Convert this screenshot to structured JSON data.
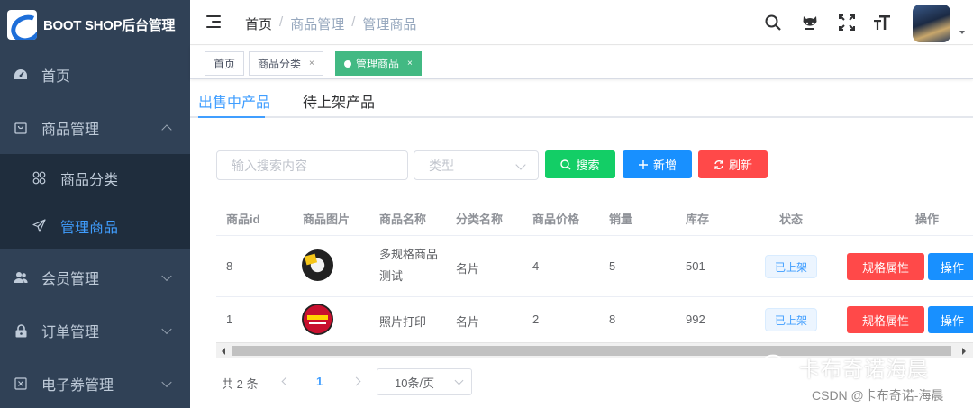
{
  "app": {
    "title": "BOOT SHOP后台管理"
  },
  "sidebar": {
    "items": [
      {
        "label": "首页",
        "icon": "dashboard-icon"
      },
      {
        "label": "商品管理",
        "icon": "shopping-bag-icon",
        "expanded": true
      },
      {
        "label": "会员管理",
        "icon": "users-icon"
      },
      {
        "label": "订单管理",
        "icon": "lock-icon"
      },
      {
        "label": "电子券管理",
        "icon": "coupon-icon"
      }
    ],
    "submenu": [
      {
        "label": "商品分类",
        "icon": "categories-icon"
      },
      {
        "label": "管理商品",
        "icon": "send-icon",
        "active": true
      }
    ]
  },
  "navbar": {
    "breadcrumb": [
      "首页",
      "商品管理",
      "管理商品"
    ],
    "separator": "/",
    "icons": [
      "search-icon",
      "github-icon",
      "fullscreen-icon",
      "font-size-icon"
    ]
  },
  "tags": [
    {
      "label": "首页"
    },
    {
      "label": "商品分类",
      "close": "×"
    },
    {
      "label": "管理商品",
      "close": "×",
      "active": true
    }
  ],
  "product_tabs": [
    "出售中产品",
    "待上架产品"
  ],
  "filters": {
    "search_placeholder": "输入搜索内容",
    "type_placeholder": "类型",
    "search_btn": "搜索",
    "add_btn": "新增",
    "refresh_btn": "刷新"
  },
  "table": {
    "headers": [
      "商品id",
      "商品图片",
      "商品名称",
      "分类名称",
      "商品价格",
      "销量",
      "库存",
      "状态",
      "操作"
    ],
    "rows": [
      {
        "id": "8",
        "name": "多规格商品测试",
        "category": "名片",
        "price": "4",
        "sales": "5",
        "stock": "501",
        "status": "已上架",
        "op_spec": "规格属性",
        "op_more": "操作"
      },
      {
        "id": "1",
        "name": "照片打印",
        "category": "名片",
        "price": "2",
        "sales": "8",
        "stock": "992",
        "status": "已上架",
        "op_spec": "规格属性",
        "op_more": "操作"
      }
    ]
  },
  "pagination": {
    "total": "共 2 条",
    "current": "1",
    "page_size": "10条/页"
  },
  "watermark": {
    "title": "卡布奇诺海晨",
    "source": "CSDN @卡布奇诺-海晨"
  },
  "colors": {
    "sidebar_bg": "#304156",
    "submenu_bg": "#1f2d3d",
    "primary": "#409eff",
    "success": "#13ce66",
    "danger": "#ff4949",
    "tag_active": "#42b983"
  }
}
